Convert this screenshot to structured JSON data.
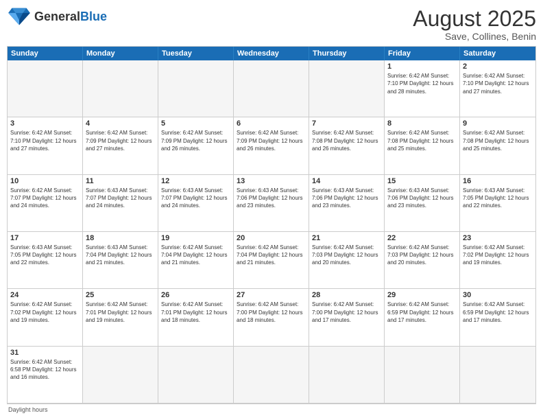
{
  "header": {
    "logo_general": "General",
    "logo_blue": "Blue",
    "main_title": "August 2025",
    "subtitle": "Save, Collines, Benin"
  },
  "day_headers": [
    "Sunday",
    "Monday",
    "Tuesday",
    "Wednesday",
    "Thursday",
    "Friday",
    "Saturday"
  ],
  "cells": [
    {
      "date": "",
      "info": "",
      "empty": true
    },
    {
      "date": "",
      "info": "",
      "empty": true
    },
    {
      "date": "",
      "info": "",
      "empty": true
    },
    {
      "date": "",
      "info": "",
      "empty": true
    },
    {
      "date": "",
      "info": "",
      "empty": true
    },
    {
      "date": "1",
      "info": "Sunrise: 6:42 AM\nSunset: 7:10 PM\nDaylight: 12 hours and 28 minutes.",
      "empty": false
    },
    {
      "date": "2",
      "info": "Sunrise: 6:42 AM\nSunset: 7:10 PM\nDaylight: 12 hours and 27 minutes.",
      "empty": false
    },
    {
      "date": "3",
      "info": "Sunrise: 6:42 AM\nSunset: 7:10 PM\nDaylight: 12 hours and 27 minutes.",
      "empty": false
    },
    {
      "date": "4",
      "info": "Sunrise: 6:42 AM\nSunset: 7:09 PM\nDaylight: 12 hours and 27 minutes.",
      "empty": false
    },
    {
      "date": "5",
      "info": "Sunrise: 6:42 AM\nSunset: 7:09 PM\nDaylight: 12 hours and 26 minutes.",
      "empty": false
    },
    {
      "date": "6",
      "info": "Sunrise: 6:42 AM\nSunset: 7:09 PM\nDaylight: 12 hours and 26 minutes.",
      "empty": false
    },
    {
      "date": "7",
      "info": "Sunrise: 6:42 AM\nSunset: 7:08 PM\nDaylight: 12 hours and 26 minutes.",
      "empty": false
    },
    {
      "date": "8",
      "info": "Sunrise: 6:42 AM\nSunset: 7:08 PM\nDaylight: 12 hours and 25 minutes.",
      "empty": false
    },
    {
      "date": "9",
      "info": "Sunrise: 6:42 AM\nSunset: 7:08 PM\nDaylight: 12 hours and 25 minutes.",
      "empty": false
    },
    {
      "date": "10",
      "info": "Sunrise: 6:42 AM\nSunset: 7:07 PM\nDaylight: 12 hours and 24 minutes.",
      "empty": false
    },
    {
      "date": "11",
      "info": "Sunrise: 6:43 AM\nSunset: 7:07 PM\nDaylight: 12 hours and 24 minutes.",
      "empty": false
    },
    {
      "date": "12",
      "info": "Sunrise: 6:43 AM\nSunset: 7:07 PM\nDaylight: 12 hours and 24 minutes.",
      "empty": false
    },
    {
      "date": "13",
      "info": "Sunrise: 6:43 AM\nSunset: 7:06 PM\nDaylight: 12 hours and 23 minutes.",
      "empty": false
    },
    {
      "date": "14",
      "info": "Sunrise: 6:43 AM\nSunset: 7:06 PM\nDaylight: 12 hours and 23 minutes.",
      "empty": false
    },
    {
      "date": "15",
      "info": "Sunrise: 6:43 AM\nSunset: 7:06 PM\nDaylight: 12 hours and 23 minutes.",
      "empty": false
    },
    {
      "date": "16",
      "info": "Sunrise: 6:43 AM\nSunset: 7:05 PM\nDaylight: 12 hours and 22 minutes.",
      "empty": false
    },
    {
      "date": "17",
      "info": "Sunrise: 6:43 AM\nSunset: 7:05 PM\nDaylight: 12 hours and 22 minutes.",
      "empty": false
    },
    {
      "date": "18",
      "info": "Sunrise: 6:43 AM\nSunset: 7:04 PM\nDaylight: 12 hours and 21 minutes.",
      "empty": false
    },
    {
      "date": "19",
      "info": "Sunrise: 6:42 AM\nSunset: 7:04 PM\nDaylight: 12 hours and 21 minutes.",
      "empty": false
    },
    {
      "date": "20",
      "info": "Sunrise: 6:42 AM\nSunset: 7:04 PM\nDaylight: 12 hours and 21 minutes.",
      "empty": false
    },
    {
      "date": "21",
      "info": "Sunrise: 6:42 AM\nSunset: 7:03 PM\nDaylight: 12 hours and 20 minutes.",
      "empty": false
    },
    {
      "date": "22",
      "info": "Sunrise: 6:42 AM\nSunset: 7:03 PM\nDaylight: 12 hours and 20 minutes.",
      "empty": false
    },
    {
      "date": "23",
      "info": "Sunrise: 6:42 AM\nSunset: 7:02 PM\nDaylight: 12 hours and 19 minutes.",
      "empty": false
    },
    {
      "date": "24",
      "info": "Sunrise: 6:42 AM\nSunset: 7:02 PM\nDaylight: 12 hours and 19 minutes.",
      "empty": false
    },
    {
      "date": "25",
      "info": "Sunrise: 6:42 AM\nSunset: 7:01 PM\nDaylight: 12 hours and 19 minutes.",
      "empty": false
    },
    {
      "date": "26",
      "info": "Sunrise: 6:42 AM\nSunset: 7:01 PM\nDaylight: 12 hours and 18 minutes.",
      "empty": false
    },
    {
      "date": "27",
      "info": "Sunrise: 6:42 AM\nSunset: 7:00 PM\nDaylight: 12 hours and 18 minutes.",
      "empty": false
    },
    {
      "date": "28",
      "info": "Sunrise: 6:42 AM\nSunset: 7:00 PM\nDaylight: 12 hours and 17 minutes.",
      "empty": false
    },
    {
      "date": "29",
      "info": "Sunrise: 6:42 AM\nSunset: 6:59 PM\nDaylight: 12 hours and 17 minutes.",
      "empty": false
    },
    {
      "date": "30",
      "info": "Sunrise: 6:42 AM\nSunset: 6:59 PM\nDaylight: 12 hours and 17 minutes.",
      "empty": false
    },
    {
      "date": "31",
      "info": "Sunrise: 6:42 AM\nSunset: 6:58 PM\nDaylight: 12 hours and 16 minutes.",
      "empty": false
    },
    {
      "date": "",
      "info": "",
      "empty": true
    },
    {
      "date": "",
      "info": "",
      "empty": true
    },
    {
      "date": "",
      "info": "",
      "empty": true
    },
    {
      "date": "",
      "info": "",
      "empty": true
    },
    {
      "date": "",
      "info": "",
      "empty": true
    },
    {
      "date": "",
      "info": "",
      "empty": true
    }
  ],
  "footer": {
    "note": "Daylight hours"
  }
}
